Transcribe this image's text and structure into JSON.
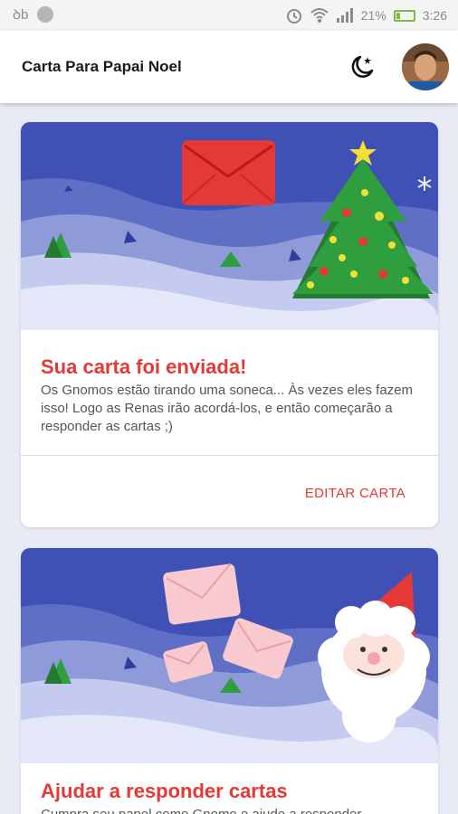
{
  "status_bar": {
    "time": "3:26",
    "battery": "21%"
  },
  "app_bar": {
    "title": "Carta Para Papai Noel"
  },
  "cards": [
    {
      "title": "Sua carta foi enviada!",
      "body": "Os Gnomos estão tirando uma soneca... Às vezes eles fazem isso! Logo as Renas irão acordá-los, e então começarão a responder as cartas ;)",
      "action": "EDITAR CARTA"
    },
    {
      "title": "Ajudar a responder cartas",
      "body": "Cumpra seu papel como Gnomo e ajude a responder"
    }
  ],
  "colors": {
    "accent": "#e53935",
    "banner_blue": "#3f51b5",
    "tree_green": "#2e9e3e"
  },
  "icons": [
    "signal-icon",
    "alarm-icon",
    "wifi-icon",
    "battery-icon",
    "night-mode-icon",
    "avatar"
  ]
}
